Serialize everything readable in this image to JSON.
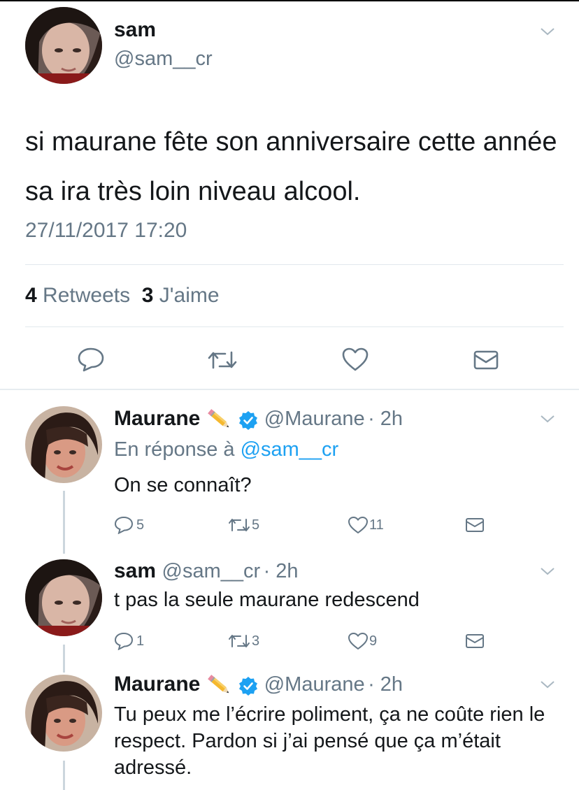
{
  "main_tweet": {
    "name": "sam",
    "handle": "@sam__cr",
    "text": "si maurane fête son anniversaire cette année sa ira très loin niveau alcool.",
    "timestamp": "27/11/2017 17:20",
    "retweets_count": "4",
    "retweets_label": "Retweets",
    "likes_count": "3",
    "likes_label": "J'aime"
  },
  "replies": [
    {
      "name": "Maurane",
      "emoji_icon": "pencil-icon",
      "verified": true,
      "handle": "@Maurane",
      "time": "· 2h",
      "reply_prefix": "En réponse à",
      "reply_target": "@sam__cr",
      "text": "On se connaît?",
      "replies": "5",
      "retweets": "5",
      "likes": "11"
    },
    {
      "name": "sam",
      "handle": "@sam__cr",
      "time": "· 2h",
      "text": "t pas la seule maurane redescend",
      "replies": "1",
      "retweets": "3",
      "likes": "9"
    },
    {
      "name": "Maurane",
      "emoji_icon": "pencil-icon",
      "verified": true,
      "handle": "@Maurane",
      "time": "· 2h",
      "text": "Tu peux me l’écrire poliment, ça ne coûte rien le respect. Pardon si j’ai pensé que ça m’était adressé."
    }
  ],
  "colors": {
    "accent": "#1da1f2",
    "muted": "#657786",
    "text": "#14171a",
    "divider": "#e1e8ed"
  }
}
